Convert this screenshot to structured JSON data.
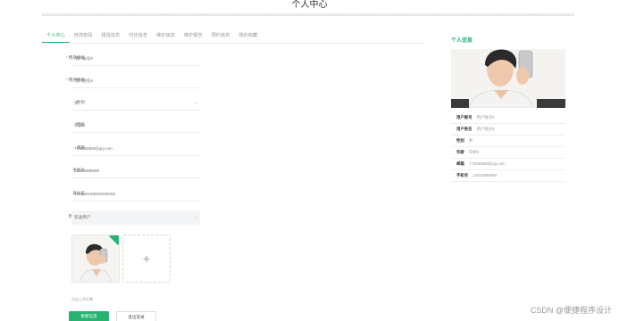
{
  "page": {
    "title": "个人中心"
  },
  "tabs": [
    {
      "label": "个人中心",
      "active": true
    },
    {
      "label": "修改密码",
      "active": false
    },
    {
      "label": "租赁信息",
      "active": false
    },
    {
      "label": "归还信息",
      "active": false
    },
    {
      "label": "维护信息",
      "active": false
    },
    {
      "label": "维护报告",
      "active": false
    },
    {
      "label": "预约信息",
      "active": false
    },
    {
      "label": "我的收藏",
      "active": false
    }
  ],
  "form": {
    "account": {
      "label": "用户账号",
      "required": true,
      "value": "用户账号8"
    },
    "name": {
      "label": "用户姓名",
      "required": true,
      "value": "用户姓名8"
    },
    "gender": {
      "label": "性别",
      "value": "男"
    },
    "age": {
      "label": "年龄",
      "value": "年龄8"
    },
    "email": {
      "label": "邮箱",
      "value": "773890888@qq.com"
    },
    "phone": {
      "label": "手机号",
      "value": "13823888888"
    },
    "idcard": {
      "label": "身份证",
      "value": "440300199808080008"
    },
    "usertype": {
      "label": "用户类型",
      "value": "普通用户"
    },
    "avatar": {
      "label": "头像",
      "plus": "+",
      "tip": "点击上传头像"
    }
  },
  "buttons": {
    "update": "更新信息",
    "logout": "退出登录"
  },
  "info": {
    "title": "个人信息",
    "rows": [
      {
        "k": "用户账号",
        "v": "用户账号8"
      },
      {
        "k": "用户姓名",
        "v": "用户姓名8"
      },
      {
        "k": "性别",
        "v": "男"
      },
      {
        "k": "年龄",
        "v": "年龄8"
      },
      {
        "k": "邮箱",
        "v": "773890888@qq.com"
      },
      {
        "k": "手机号",
        "v": "13823888888"
      }
    ]
  },
  "watermark": "CSDN @便捷程序设计",
  "colors": {
    "accent": "#29b373",
    "required": "#e25c5c"
  }
}
